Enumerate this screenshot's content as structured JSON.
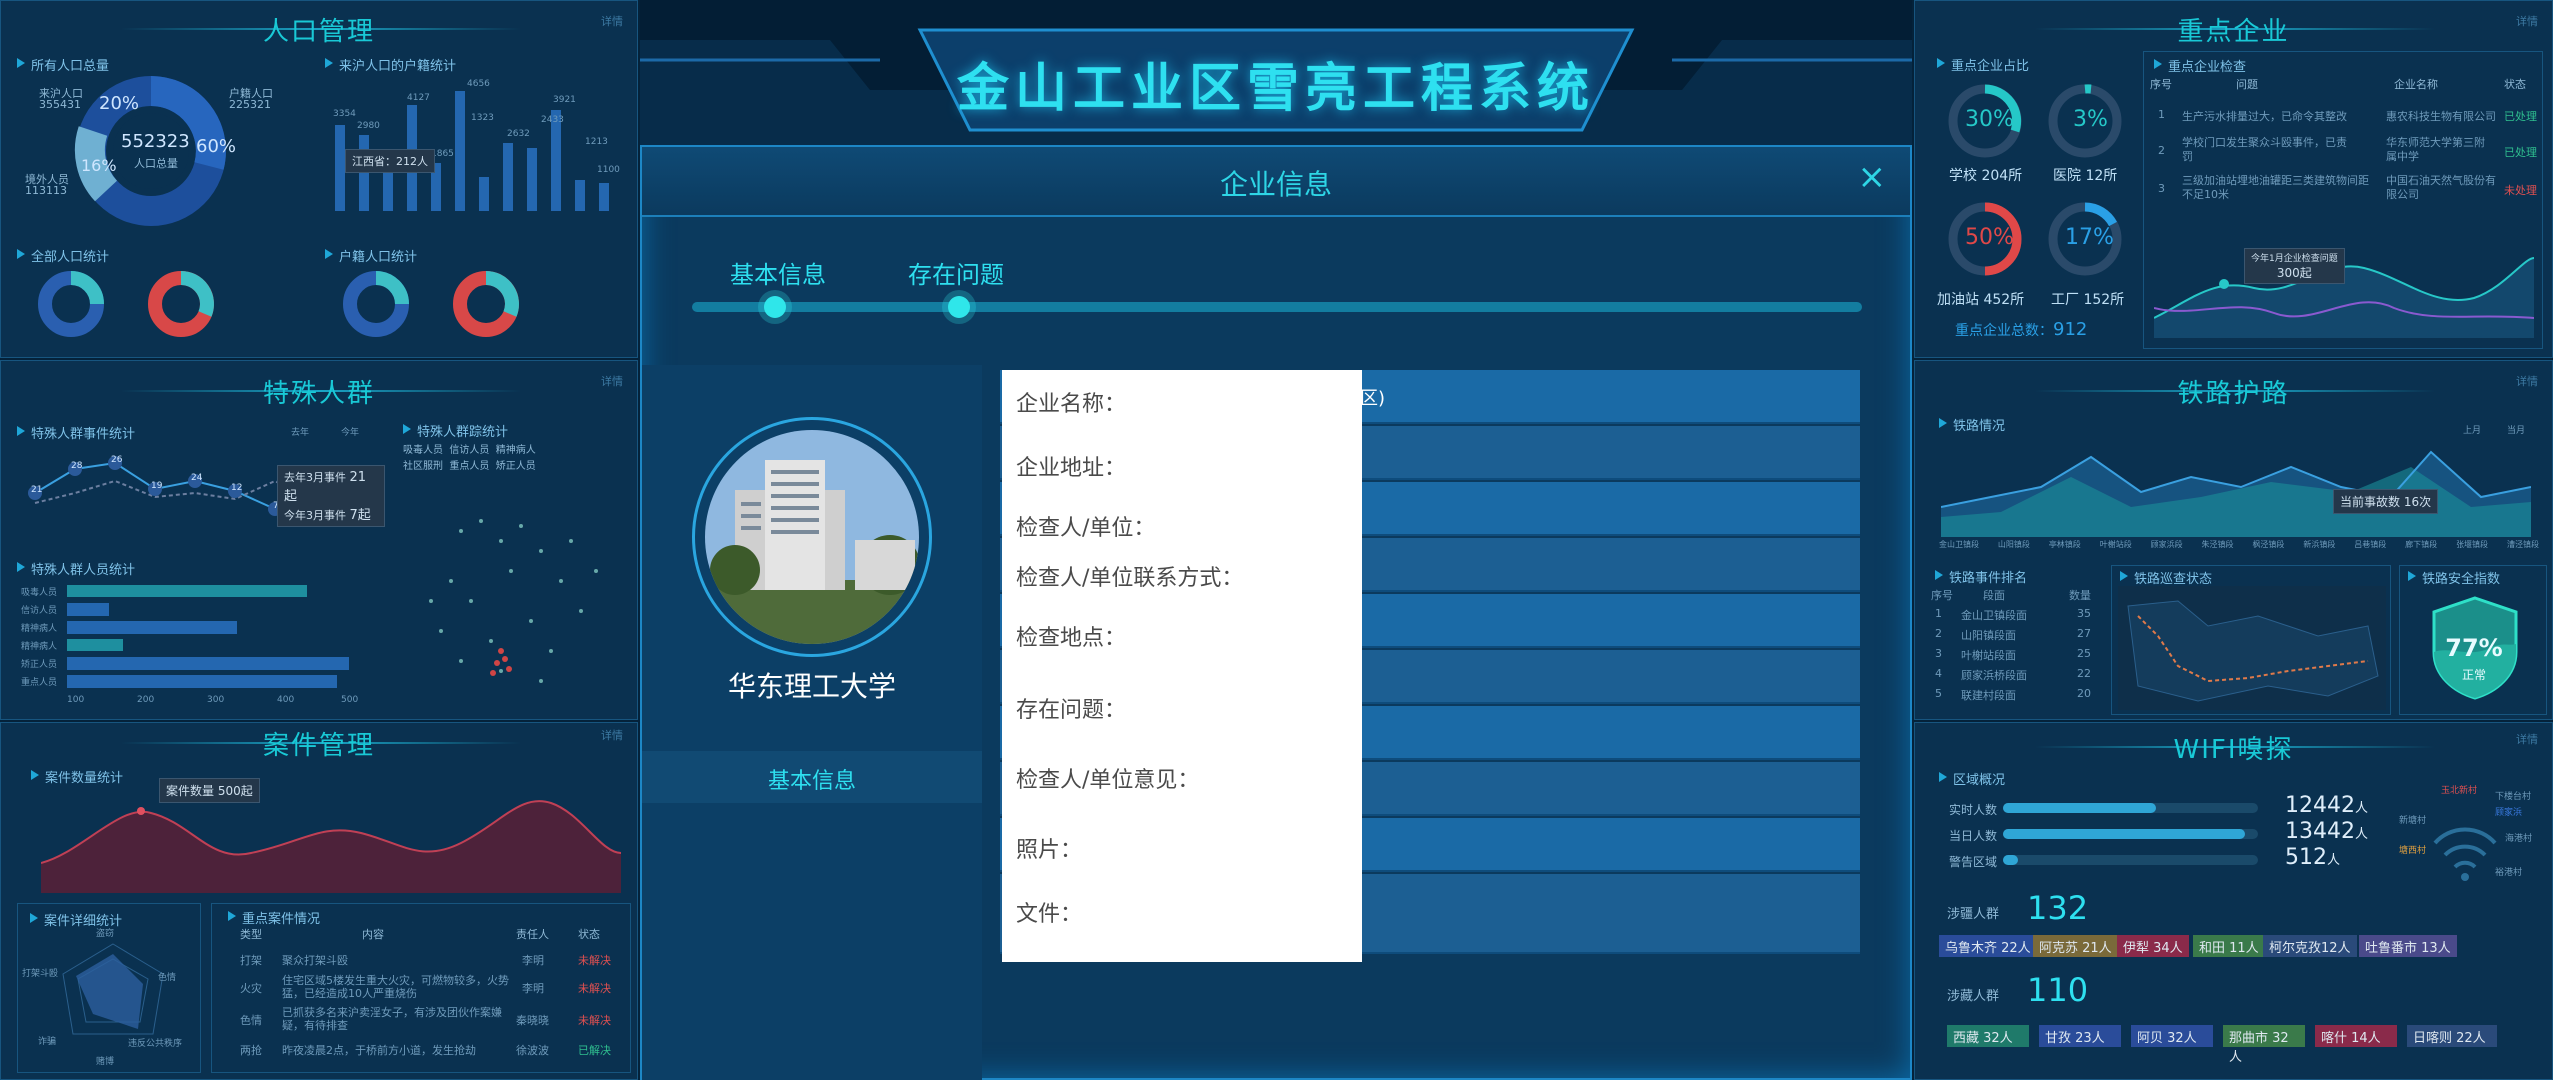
{
  "header": {
    "title": "金山工业区雪亮工程系统"
  },
  "left": {
    "population": {
      "title": "人口管理",
      "detail": "详情",
      "total_title": "所有人口总量",
      "donut_center_value": "552323",
      "donut_center_label": "人口总量",
      "pct_20": "20%",
      "pct_16": "16%",
      "pct_60": "60%",
      "huji_label": "来沪人口",
      "huji_value": "355431",
      "hukou_label": "户籍人口",
      "hukou_value": "225321",
      "jingwai_label": "境外人员",
      "jingwai_value": "113113",
      "origin_title": "来沪人口的户籍统计",
      "origin_values": [
        "3354",
        "2980",
        "2100",
        "4127",
        "1865",
        "4656",
        "1323",
        "2632",
        "2433",
        "3921",
        "1213",
        "1100"
      ],
      "tooltip": "江西省：212人",
      "all_stats_title": "全部人口统计",
      "hukou_stats_title": "户籍人口统计"
    },
    "special": {
      "title": "特殊人群",
      "detail": "详情",
      "events_title": "特殊人群事件统计",
      "legend_last": "去年",
      "legend_this": "今年",
      "points": [
        "21",
        "28",
        "26",
        "19",
        "24",
        "12",
        "7"
      ],
      "ev_last": "去年3月事件",
      "ev_last_val": "21起",
      "ev_this": "今年3月事件",
      "ev_this_val": "7起",
      "track_title": "特殊人群踪统计",
      "track_legend": [
        "吸毒人员",
        "信访人员",
        "精神病人",
        "社区服刑",
        "重点人员",
        "矫正人员"
      ],
      "persons_title": "特殊人群人员统计",
      "persons_labels": [
        "吸毒人员",
        "信访人员",
        "精神病人",
        "精神病人",
        "矫正人员",
        "重点人员"
      ],
      "persons_values": [
        380,
        60,
        240,
        80,
        410,
        390
      ],
      "persons_ticks": [
        "100",
        "200",
        "300",
        "400",
        "500"
      ]
    },
    "cases": {
      "title": "案件管理",
      "detail": "详情",
      "count_title": "案件数量统计",
      "tooltip": "案件数量 500起",
      "detail_title": "案件详细统计",
      "radar_labels": [
        "盗窃",
        "色情",
        "违反公共秩序",
        "赌博",
        "诈骗",
        "打架斗殴"
      ],
      "key_title": "重点案件情况",
      "key_headers": [
        "类型",
        "内容",
        "责任人",
        "状态"
      ],
      "key_rows": [
        {
          "type": "打架",
          "content": "聚众打架斗殴",
          "owner": "李明",
          "status": "未解决"
        },
        {
          "type": "火灾",
          "content": "住宅区域5楼发生重大火灾，可燃物较多，火势猛，已经造成10人严重烧伤",
          "owner": "李明",
          "status": "未解决"
        },
        {
          "type": "色情",
          "content": "已抓获多名来沪卖淫女子，有涉及团伙作案嫌疑，有待排查",
          "owner": "秦晓晓",
          "status": "未解决"
        },
        {
          "type": "两抢",
          "content": "昨夜凌晨2点，于桥前方小道，发生抢劫",
          "owner": "徐波波",
          "status": "已解决"
        }
      ]
    }
  },
  "modal": {
    "title": "企业信息",
    "close": "×",
    "steps": [
      "基本信息",
      "存在问题"
    ],
    "company_name": "华东理工大学",
    "side_tab": "基本信息",
    "peek_text": "区)",
    "fields": [
      "企业名称：",
      "企业地址：",
      "检查人/单位：",
      "检查人/单位联系方式：",
      "检查地点：",
      "存在问题：",
      "检查人/单位意见：",
      "照片：",
      "文件："
    ]
  },
  "right": {
    "enterprise": {
      "title": "重点企业",
      "detail": "详情",
      "ratio_title": "重点企业占比",
      "gauges": [
        {
          "pct": "30%",
          "label": "学校 204所",
          "color": "#25c8c8"
        },
        {
          "pct": "3%",
          "label": "医院 12所",
          "color": "#25c8c8"
        },
        {
          "pct": "50%",
          "label": "加油站 452所",
          "color": "#e04848"
        },
        {
          "pct": "17%",
          "label": "工厂 152所",
          "color": "#2aa0e6"
        }
      ],
      "total_label": "重点企业总数：",
      "total_value": "912",
      "check_title": "重点企业检查",
      "check_headers": [
        "序号",
        "问题",
        "企业名称",
        "状态"
      ],
      "check_rows": [
        {
          "no": "1",
          "issue": "生产污水排量过大，已命令其整改",
          "name": "惠农科技生物有限公司",
          "status": "已处理"
        },
        {
          "no": "2",
          "issue": "学校门口发生聚众斗殴事件，已责罚",
          "name": "华东师范大学第三附属中学",
          "status": "已处理"
        },
        {
          "no": "3",
          "issue": "三级加油站埋地油罐距三类建筑物间距不足10米",
          "name": "中国石油天然气股份有限公司",
          "status": "未处理"
        }
      ],
      "line_tooltip": "今年1月企业检查问题",
      "line_tooltip_val": "300起"
    },
    "railway": {
      "title": "铁路护路",
      "detail": "详情",
      "status_title": "铁路情况",
      "legend_up": "上月",
      "legend_this": "当月",
      "tooltip": "当前事故数 16次",
      "x_labels": [
        "金山卫镇段",
        "山阳镇段",
        "亭林镇段",
        "叶榭站段",
        "顾家浜段",
        "朱泾镇段",
        "枫泾镇段",
        "新浜镇段",
        "吕巷镇段",
        "廊下镇段",
        "张堰镇段",
        "漕泾镇段"
      ],
      "event_title": "铁路事件排名",
      "event_headers": [
        "序号",
        "段面",
        "数量"
      ],
      "event_rows": [
        {
          "no": "1",
          "name": "金山卫镇段面",
          "count": "35"
        },
        {
          "no": "2",
          "name": "山阳镇段面",
          "count": "27"
        },
        {
          "no": "3",
          "name": "叶榭站段面",
          "count": "25"
        },
        {
          "no": "4",
          "name": "顾家浜桥段面",
          "count": "22"
        },
        {
          "no": "5",
          "name": "联建村段面",
          "count": "20"
        }
      ],
      "map_title": "铁路巡查状态",
      "safety_title": "铁路安全指数",
      "safety_value": "77%",
      "safety_label": "正常"
    },
    "wifi": {
      "title": "WIFI嗅探",
      "detail": "详情",
      "area_title": "区域概况",
      "rows": [
        {
          "label": "实时人数",
          "value": "12442",
          "unit": "人",
          "fill": 0.6
        },
        {
          "label": "当日人数",
          "value": "13442",
          "unit": "人",
          "fill": 0.95
        },
        {
          "label": "警告区域",
          "value": "512",
          "unit": "人",
          "fill": 0.05
        }
      ],
      "xinjiang_label": "涉疆人群",
      "xinjiang_value": "132",
      "xinjiang_tags": [
        "乌鲁木齐 22人",
        "阿克苏 21人",
        "伊犁 34人",
        "和田 11人",
        "柯尔克孜12人",
        "吐鲁番市 13人"
      ],
      "tibet_label": "涉藏人群",
      "tibet_value": "110",
      "tibet_tags": [
        "西藏 32人",
        "甘孜 23人",
        "阿贝 32人",
        "那曲市 32人",
        "喀什 14人",
        "日喀则 22人"
      ],
      "wifi_places": [
        "玉北新村",
        "下楼台村",
        "新塘村",
        "顾家浜",
        "海港村",
        "塘西村",
        "裕港村"
      ]
    }
  }
}
